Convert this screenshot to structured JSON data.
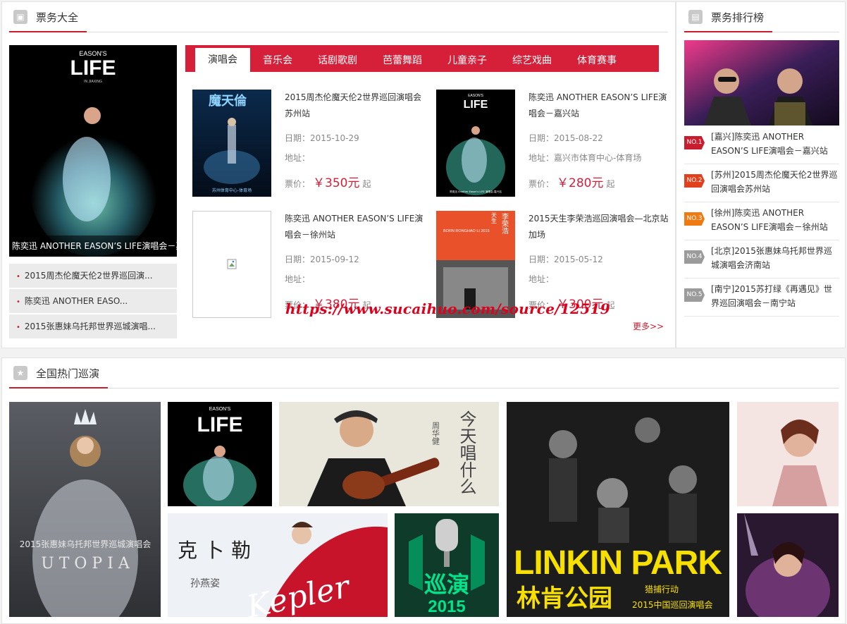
{
  "tickets": {
    "title": "票务大全",
    "featured": {
      "caption": "陈奕迅 ANOTHER EASON’S LIFE演唱会－嘉",
      "poster_title": "LIFE",
      "poster_sub": "EASON'S",
      "poster_small": "IN JIAXING"
    },
    "mini_list": [
      "2015周杰伦魔天伦2世界巡回演...",
      "陈奕迅 ANOTHER EASO...",
      "2015张惠妹乌托邦世界巡城演唱..."
    ],
    "tabs": [
      "演唱会",
      "音乐会",
      "话剧歌剧",
      "芭蕾舞蹈",
      "儿童亲子",
      "综艺戏曲",
      "体育赛事"
    ],
    "events": [
      {
        "name": "2015周杰伦魔天伦2世界巡回演唱会苏州站",
        "date": "日期：2015-10-29",
        "addr": "地址：",
        "price_label": "票价：",
        "price": "￥350元",
        "suffix": "起",
        "poster_text": "魔天倫",
        "poster_foot": "苏州体育中心-体育场"
      },
      {
        "name": "陈奕迅 ANOTHER EASON’S LIFE演唱会－嘉兴站",
        "date": "日期：2015-08-22",
        "addr": "地址：嘉兴市体育中心-体育场",
        "price_label": "票价：",
        "price": "￥280元",
        "suffix": "起",
        "poster_text": "LIFE",
        "poster_sub": "EASON'S",
        "poster_foot": "陈奕迅 Another Eason's LIFE 演唱会-嘉兴站"
      },
      {
        "name": "陈奕迅 ANOTHER EASON’S LIFE演唱会－徐州站",
        "date": "日期：2015-09-12",
        "addr": "地址：",
        "price_label": "票价：",
        "price": "￥380元",
        "suffix": "起"
      },
      {
        "name": "2015天生李荣浩巡回演唱会—北京站加场",
        "date": "日期：2015-05-12",
        "addr": "地址：",
        "price_label": "票价：",
        "price": "￥300元",
        "suffix": "起",
        "poster_text": "李荣浩",
        "poster_sub": "BORN RONGHAO LI 2015",
        "poster_side": "天生"
      }
    ],
    "more": "更多>>",
    "watermark": "https://www.sucaihuo.com/source/12519"
  },
  "ranking": {
    "title": "票务排行榜",
    "items": [
      {
        "badge": "NO.1",
        "color": "#c81d2f",
        "text": "[嘉兴]陈奕迅 ANOTHER EASON’S LIFE演唱会－嘉兴站"
      },
      {
        "badge": "NO.2",
        "color": "#e0401c",
        "text": "[苏州]2015周杰伦魔天伦2世界巡回演唱会苏州站"
      },
      {
        "badge": "NO.3",
        "color": "#f07a12",
        "text": "[徐州]陈奕迅 ANOTHER EASON’S LIFE演唱会－徐州站"
      },
      {
        "badge": "NO.4",
        "color": "#9b9b9b",
        "text": "[北京]2015张惠妹乌托邦世界巡城演唱会济南站"
      },
      {
        "badge": "NO.5",
        "color": "#9b9b9b",
        "text": "[南宁]2015苏打绿《再遇见》世界巡回演唱会－南宁站"
      }
    ]
  },
  "hot": {
    "title": "全国热门巡演",
    "tiles": {
      "utopia_title": "2015张惠妹乌托邦世界巡城演唱会",
      "utopia_word": "U T O P I A",
      "life_sub": "EASON'S",
      "life_title": "LIFE",
      "zhou_name": "周华健",
      "zhou_words": "今天唱什么",
      "kepler_cn": "克卜勒",
      "kepler_name": "孙燕姿",
      "kepler_en": "Kepler",
      "xunyan": "巡演",
      "xunyan_year": "2015",
      "linkin_en": "LINKIN PARK",
      "linkin_cn": "林肯公园",
      "linkin_sub1": "猎捕行动",
      "linkin_sub2": "2015中国巡回演唱会"
    }
  },
  "colors": {
    "accent": "#c81d2f",
    "tab_bar": "#d6203a",
    "price": "#d6203a"
  }
}
